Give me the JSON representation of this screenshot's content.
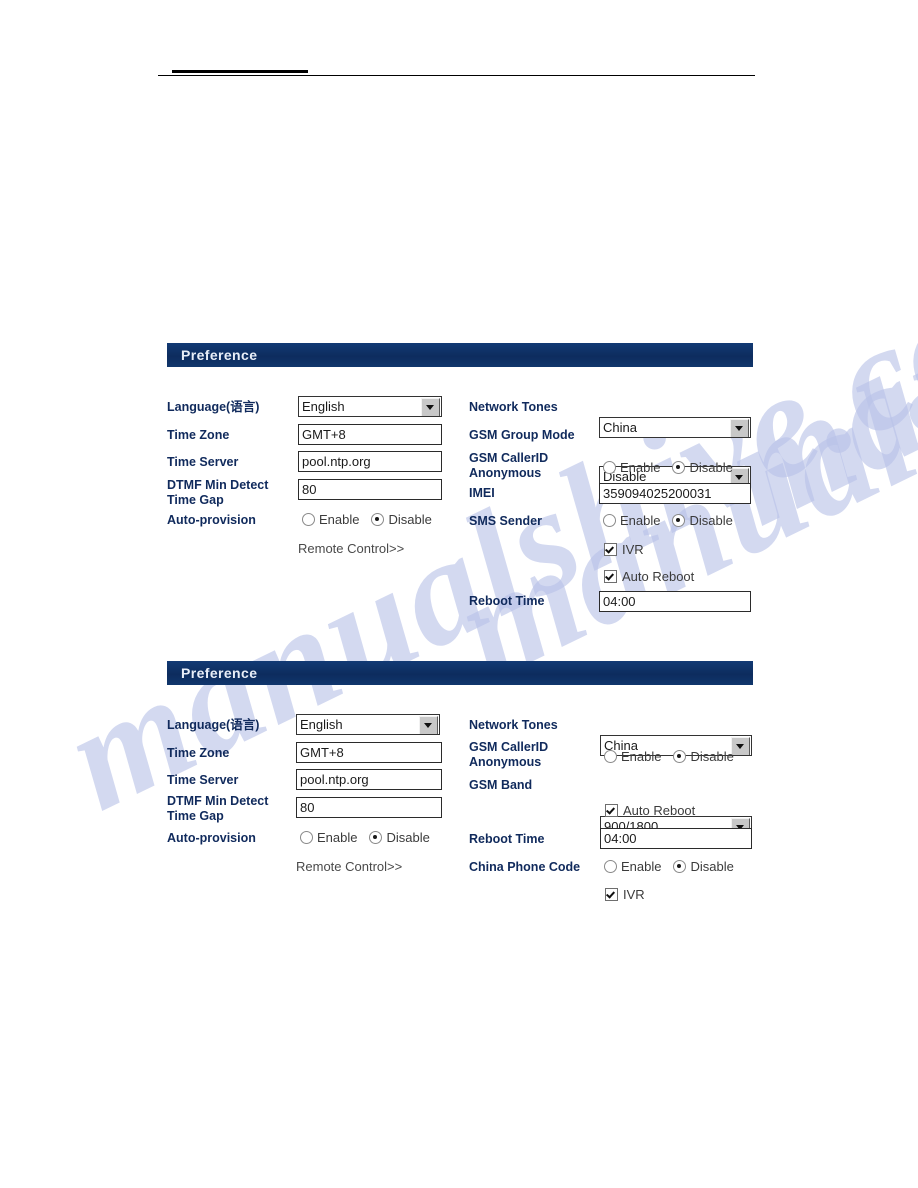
{
  "page": {
    "watermark_text": "manualshive.com"
  },
  "header": {
    "rule_label": "header-rule"
  },
  "panels": [
    {
      "title": "Preference",
      "left_column": [
        {
          "label": "Language(语言)",
          "control": "select",
          "value": "English"
        },
        {
          "label": "Time Zone",
          "control": "text",
          "value": "GMT+8"
        },
        {
          "label": "Time Server",
          "control": "text",
          "value": "pool.ntp.org"
        },
        {
          "label": "DTMF Min Detect\nTime Gap",
          "control": "text",
          "value": "80"
        },
        {
          "label": "Auto-provision",
          "control": "radio",
          "options": [
            "Enable",
            "Disable"
          ],
          "value": "Disable"
        }
      ],
      "left_link": "Remote Control>>",
      "right_column": [
        {
          "label": "Network Tones",
          "control": "select",
          "value": "China"
        },
        {
          "label": "GSM Group Mode",
          "control": "select",
          "value": "Disable"
        },
        {
          "label": "GSM CallerID\nAnonymous",
          "control": "radio",
          "options": [
            "Enable",
            "Disable"
          ],
          "value": "Disable"
        },
        {
          "label": "IMEI",
          "control": "text",
          "value": "359094025200031"
        },
        {
          "label": "SMS Sender",
          "control": "radio",
          "options": [
            "Enable",
            "Disable"
          ],
          "value": "Disable"
        },
        {
          "label": "",
          "control": "checkbox",
          "check_label": "IVR",
          "checked": true
        },
        {
          "label": "",
          "control": "checkbox",
          "check_label": "Auto Reboot",
          "checked": true
        },
        {
          "label": "Reboot Time",
          "control": "text",
          "value": "04:00"
        }
      ]
    },
    {
      "title": "Preference",
      "left_column": [
        {
          "label": "Language(语言)",
          "control": "select",
          "value": "English"
        },
        {
          "label": "Time Zone",
          "control": "text",
          "value": "GMT+8"
        },
        {
          "label": "Time Server",
          "control": "text",
          "value": "pool.ntp.org"
        },
        {
          "label": "DTMF Min Detect\nTime Gap",
          "control": "text",
          "value": "80"
        },
        {
          "label": "Auto-provision",
          "control": "radio",
          "options": [
            "Enable",
            "Disable"
          ],
          "value": "Disable"
        }
      ],
      "left_link": "Remote Control>>",
      "right_column": [
        {
          "label": "Network Tones",
          "control": "select",
          "value": "China"
        },
        {
          "label": "GSM CallerID\nAnonymous",
          "control": "radio",
          "options": [
            "Enable",
            "Disable"
          ],
          "value": "Disable"
        },
        {
          "label": "GSM Band",
          "control": "select",
          "value": "900/1800"
        },
        {
          "label": "",
          "control": "checkbox",
          "check_label": "Auto Reboot",
          "checked": true
        },
        {
          "label": "Reboot Time",
          "control": "text",
          "value": "04:00"
        },
        {
          "label": "China Phone Code",
          "control": "radio",
          "options": [
            "Enable",
            "Disable"
          ],
          "value": "Disable"
        },
        {
          "label": "",
          "control": "checkbox",
          "check_label": "IVR",
          "checked": true
        }
      ]
    }
  ],
  "colors": {
    "panel_title_bg": "#0f3268",
    "label_text": "#102a5c",
    "watermark": "#b9c2e8"
  }
}
